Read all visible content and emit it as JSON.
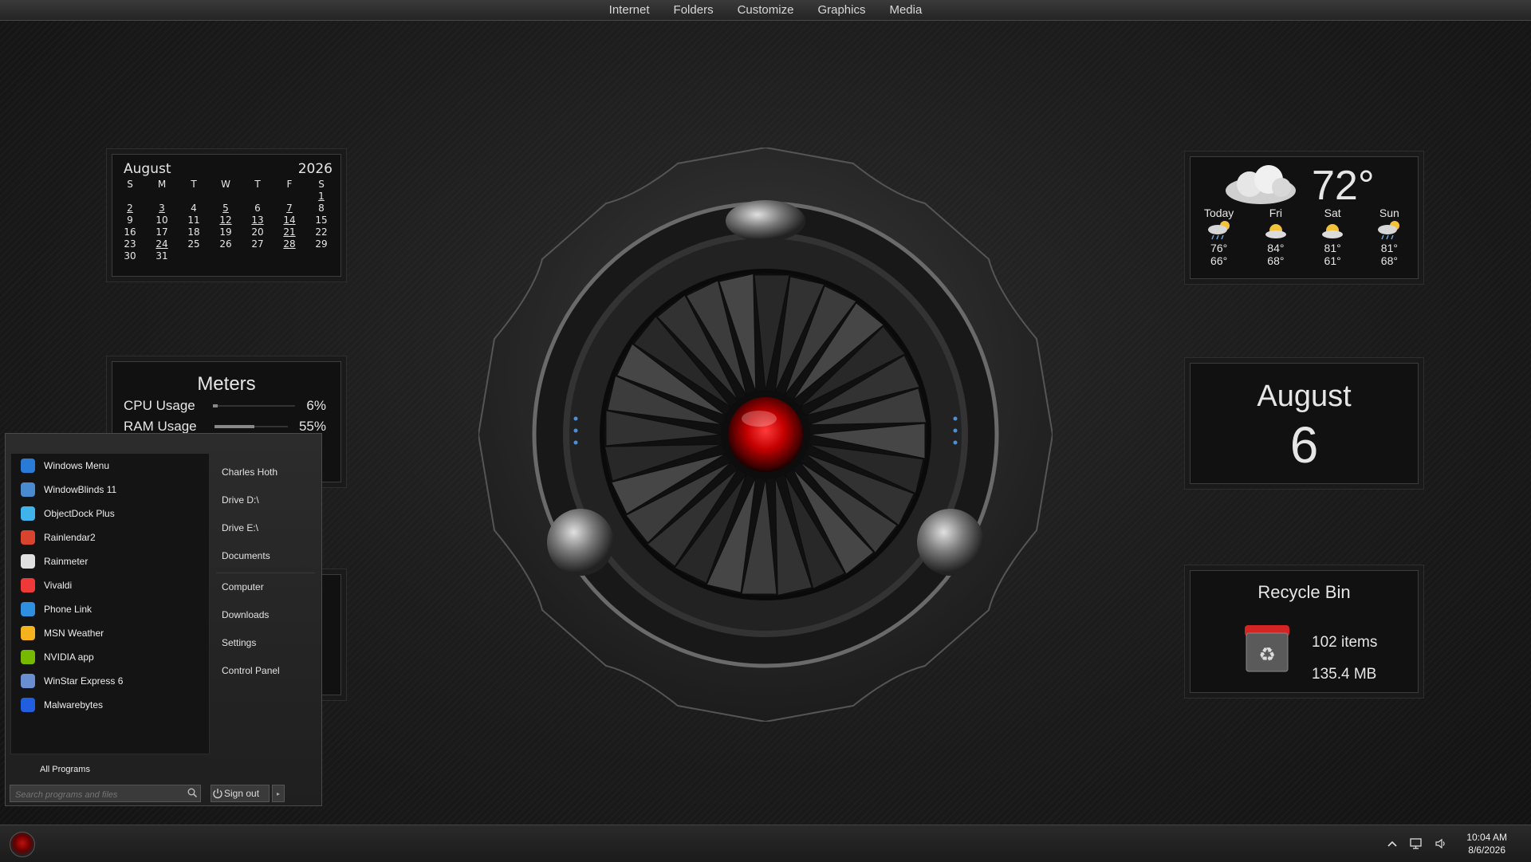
{
  "topbar": {
    "items": [
      "Internet",
      "Folders",
      "Customize",
      "Graphics",
      "Media"
    ]
  },
  "calendar": {
    "month": "August",
    "year": "2026",
    "weekdays": [
      "S",
      "M",
      "T",
      "W",
      "T",
      "F",
      "S"
    ],
    "days": [
      [
        "",
        "",
        "",
        "",
        "",
        "",
        "1"
      ],
      [
        "2",
        "3",
        "4",
        "5",
        "6",
        "7",
        "8"
      ],
      [
        "9",
        "10",
        "11",
        "12",
        "13",
        "14",
        "15"
      ],
      [
        "16",
        "17",
        "18",
        "19",
        "20",
        "21",
        "22"
      ],
      [
        "23",
        "24",
        "25",
        "26",
        "27",
        "28",
        "29"
      ],
      [
        "30",
        "31",
        "",
        "",
        "",
        "",
        ""
      ]
    ],
    "underlined": [
      "1",
      "2",
      "3",
      "5",
      "7",
      "12",
      "13",
      "14",
      "21",
      "24",
      "28"
    ]
  },
  "meters": {
    "title": "Meters",
    "rows": [
      {
        "label": "CPU Usage",
        "value": "6%",
        "fraction": 0.06
      },
      {
        "label": "RAM Usage",
        "value": "55%",
        "fraction": 0.55
      }
    ]
  },
  "weather": {
    "current_temp": "72°",
    "current_icon": "cloudy-icon",
    "days": [
      {
        "name": "Today",
        "icon": "rain-sun-icon",
        "high": "76°",
        "low": "66°"
      },
      {
        "name": "Fri",
        "icon": "partly-sunny-icon",
        "high": "84°",
        "low": "68°"
      },
      {
        "name": "Sat",
        "icon": "partly-sunny-icon",
        "high": "81°",
        "low": "61°"
      },
      {
        "name": "Sun",
        "icon": "rain-sun-icon",
        "high": "81°",
        "low": "68°"
      }
    ]
  },
  "date_widget": {
    "month": "August",
    "day": "6"
  },
  "recycle_bin": {
    "title": "Recycle Bin",
    "items": "102 items",
    "size": "135.4 MB"
  },
  "start_menu": {
    "programs": [
      {
        "label": "Windows Menu",
        "icon": "windows-menu-icon",
        "color": "#2a7bd8"
      },
      {
        "label": "WindowBlinds 11",
        "icon": "windowblinds-icon",
        "color": "#4a8ad0"
      },
      {
        "label": "ObjectDock Plus",
        "icon": "objectdock-icon",
        "color": "#3fb3ea"
      },
      {
        "label": "Rainlendar2",
        "icon": "rainlendar-icon",
        "color": "#d9442e"
      },
      {
        "label": "Rainmeter",
        "icon": "rainmeter-icon",
        "color": "#e0e0e0"
      },
      {
        "label": "Vivaldi",
        "icon": "vivaldi-icon",
        "color": "#ef3939"
      },
      {
        "label": "Phone Link",
        "icon": "phone-link-icon",
        "color": "#2f8fe0"
      },
      {
        "label": "MSN Weather",
        "icon": "msn-weather-icon",
        "color": "#f5b21d"
      },
      {
        "label": "NVIDIA app",
        "icon": "nvidia-icon",
        "color": "#76b900"
      },
      {
        "label": "WinStar Express 6",
        "icon": "winstar-icon",
        "color": "#6a8fd0"
      },
      {
        "label": "Malwarebytes",
        "icon": "malwarebytes-icon",
        "color": "#1f5fe0"
      }
    ],
    "places": [
      "Charles Hoth",
      "Drive D:\\",
      "Drive E:\\",
      "Documents",
      "Computer",
      "Downloads",
      "Settings",
      "Control Panel"
    ],
    "all_programs": "All Programs",
    "search_placeholder": "Search programs and files",
    "sign_out": "Sign out"
  },
  "taskbar": {
    "time": "10:04 AM",
    "date": "8/6/2026"
  }
}
